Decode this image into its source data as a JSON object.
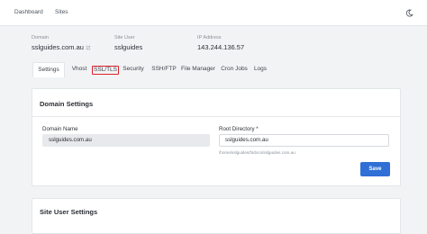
{
  "nav": {
    "items": [
      {
        "label": "Dashboard"
      },
      {
        "label": "Sites"
      }
    ]
  },
  "info": {
    "domain": {
      "label": "Domain",
      "value": "sslguides.com.au"
    },
    "site_user": {
      "label": "Site User",
      "value": "sslguides"
    },
    "ip": {
      "label": "IP Address",
      "value": "143.244.136.57"
    }
  },
  "tabs": [
    {
      "label": "Settings",
      "active": true
    },
    {
      "label": "Vhost"
    },
    {
      "label": "SSL/TLS",
      "highlighted": true
    },
    {
      "label": "Security"
    },
    {
      "label": "SSH/FTP"
    },
    {
      "label": "File Manager"
    },
    {
      "label": "Cron Jobs"
    },
    {
      "label": "Logs"
    }
  ],
  "domain_settings": {
    "title": "Domain Settings",
    "domain_name_label": "Domain Name",
    "domain_name_value": "sslguides.com.au",
    "root_dir_label": "Root Directory *",
    "root_dir_value": "sslguides.com.au",
    "root_dir_help": "/home/sslguides/htdocs/sslguides.com.au",
    "save_label": "Save"
  },
  "site_user_settings": {
    "title": "Site User Settings"
  },
  "colors": {
    "accent": "#2f6fd6",
    "highlight_border": "#e0202b",
    "page_bg": "#f2f3f5"
  }
}
